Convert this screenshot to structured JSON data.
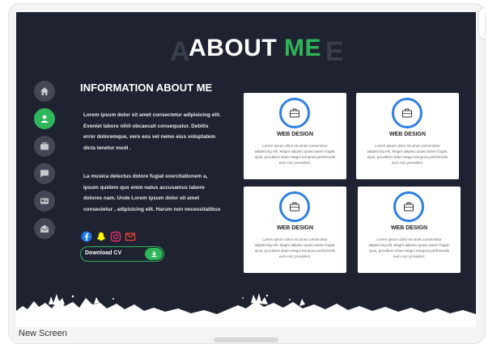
{
  "title": {
    "main": "ABOUT",
    "accent": "ME",
    "shadow_left": "A",
    "shadow_right": "E"
  },
  "nav": {
    "items": [
      {
        "icon": "home-icon"
      },
      {
        "icon": "user-icon",
        "active": true
      },
      {
        "icon": "briefcase-icon"
      },
      {
        "icon": "chat-icon"
      },
      {
        "icon": "id-card-icon"
      },
      {
        "icon": "mail-icon"
      }
    ]
  },
  "info": {
    "heading": "INFORMATION ABOUT ME",
    "para1": "Lorem ipsum dolor sit amet consectetur adipisicing elit. Eveniet labore nihil obcaecati consequatur. Debitis error doloremque, vero eos vel nemo eius voluptatem dicta tenetur modi .",
    "para2": "La musica delectus dolore fugiat exercitationem a, ipsum quidem quo enim natus accusamus labore dolores nam. Unde Lorem ipsum dolor sit amet consectetur , adipisicing elit. Harum non necessitatibus"
  },
  "socials": [
    "facebook-icon",
    "snapchat-icon",
    "instagram-icon",
    "gmail-icon"
  ],
  "cv_button": {
    "label": "Download CV",
    "icon": "download-icon"
  },
  "cards": [
    {
      "title": "WEB DESIGN",
      "text": "Lorem ipsum dolor sit amet consectetur adipisicing elit. Magni adipisci quasi autem fugiat. Quis, provident vitae! Magni tempora perferendis eum non provident."
    },
    {
      "title": "WEB DESIGN",
      "text": "Lorem ipsum dolor sit amet consectetur adipisicing elit. Magni adipisci quasi autem fugiat. Quis, provident vitae! Magni tempora perferendis eum non provident."
    },
    {
      "title": "WEB DESIGN",
      "text": "Lorem ipsum dolor sit amet consectetur adipisicing elit. Magni adipisci quasi autem fugiat. Quis, provident vitae! Magni tempora perferendis eum non provident."
    },
    {
      "title": "WEB DESIGN",
      "text": "Lorem ipsum dolor sit amet consectetur adipisicing elit. Magni adipisci quasi autem fugiat. Quis, provident vitae! Magni tempora perferendis eum non provident."
    }
  ],
  "footer_label": "New Screen",
  "colors": {
    "background": "#1f2230",
    "accent": "#2fb55a",
    "card_ring": "#2d7fe0",
    "nav_button": "#444756"
  }
}
